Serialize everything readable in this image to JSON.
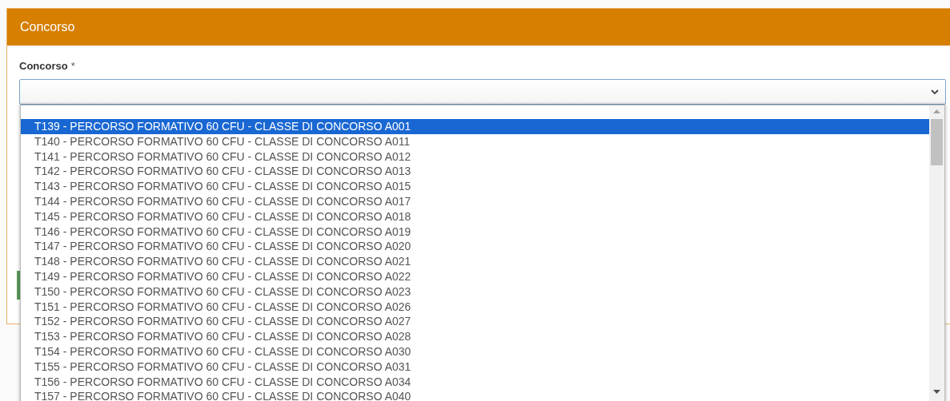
{
  "panel": {
    "title": "Concorso"
  },
  "field": {
    "label": "Concorso",
    "required_mark": "*",
    "expanded": true
  },
  "options": [
    {
      "label": "T139 - PERCORSO FORMATIVO 60 CFU - CLASSE DI CONCORSO A001",
      "selected": true
    },
    {
      "label": "T140 - PERCORSO FORMATIVO 60 CFU - CLASSE DI CONCORSO A011",
      "selected": false
    },
    {
      "label": "T141 - PERCORSO FORMATIVO 60 CFU - CLASSE DI CONCORSO A012",
      "selected": false
    },
    {
      "label": "T142 - PERCORSO FORMATIVO 60 CFU - CLASSE DI CONCORSO A013",
      "selected": false
    },
    {
      "label": "T143 - PERCORSO FORMATIVO 60 CFU - CLASSE DI CONCORSO A015",
      "selected": false
    },
    {
      "label": "T144 - PERCORSO FORMATIVO 60 CFU - CLASSE DI CONCORSO A017",
      "selected": false
    },
    {
      "label": "T145 - PERCORSO FORMATIVO 60 CFU - CLASSE DI CONCORSO A018",
      "selected": false
    },
    {
      "label": "T146 - PERCORSO FORMATIVO 60 CFU - CLASSE DI CONCORSO A019",
      "selected": false
    },
    {
      "label": "T147 - PERCORSO FORMATIVO 60 CFU - CLASSE DI CONCORSO A020",
      "selected": false
    },
    {
      "label": "T148 - PERCORSO FORMATIVO 60 CFU - CLASSE DI CONCORSO A021",
      "selected": false
    },
    {
      "label": "T149 - PERCORSO FORMATIVO 60 CFU - CLASSE DI CONCORSO A022",
      "selected": false
    },
    {
      "label": "T150 - PERCORSO FORMATIVO 60 CFU - CLASSE DI CONCORSO A023",
      "selected": false
    },
    {
      "label": "T151 - PERCORSO FORMATIVO 60 CFU - CLASSE DI CONCORSO A026",
      "selected": false
    },
    {
      "label": "T152 - PERCORSO FORMATIVO 60 CFU - CLASSE DI CONCORSO A027",
      "selected": false
    },
    {
      "label": "T153 - PERCORSO FORMATIVO 60 CFU - CLASSE DI CONCORSO A028",
      "selected": false
    },
    {
      "label": "T154 - PERCORSO FORMATIVO 60 CFU - CLASSE DI CONCORSO A030",
      "selected": false
    },
    {
      "label": "T155 - PERCORSO FORMATIVO 60 CFU - CLASSE DI CONCORSO A031",
      "selected": false
    },
    {
      "label": "T156 - PERCORSO FORMATIVO 60 CFU - CLASSE DI CONCORSO A034",
      "selected": false
    },
    {
      "label": "T157 - PERCORSO FORMATIVO 60 CFU - CLASSE DI CONCORSO A040",
      "selected": false
    }
  ]
}
